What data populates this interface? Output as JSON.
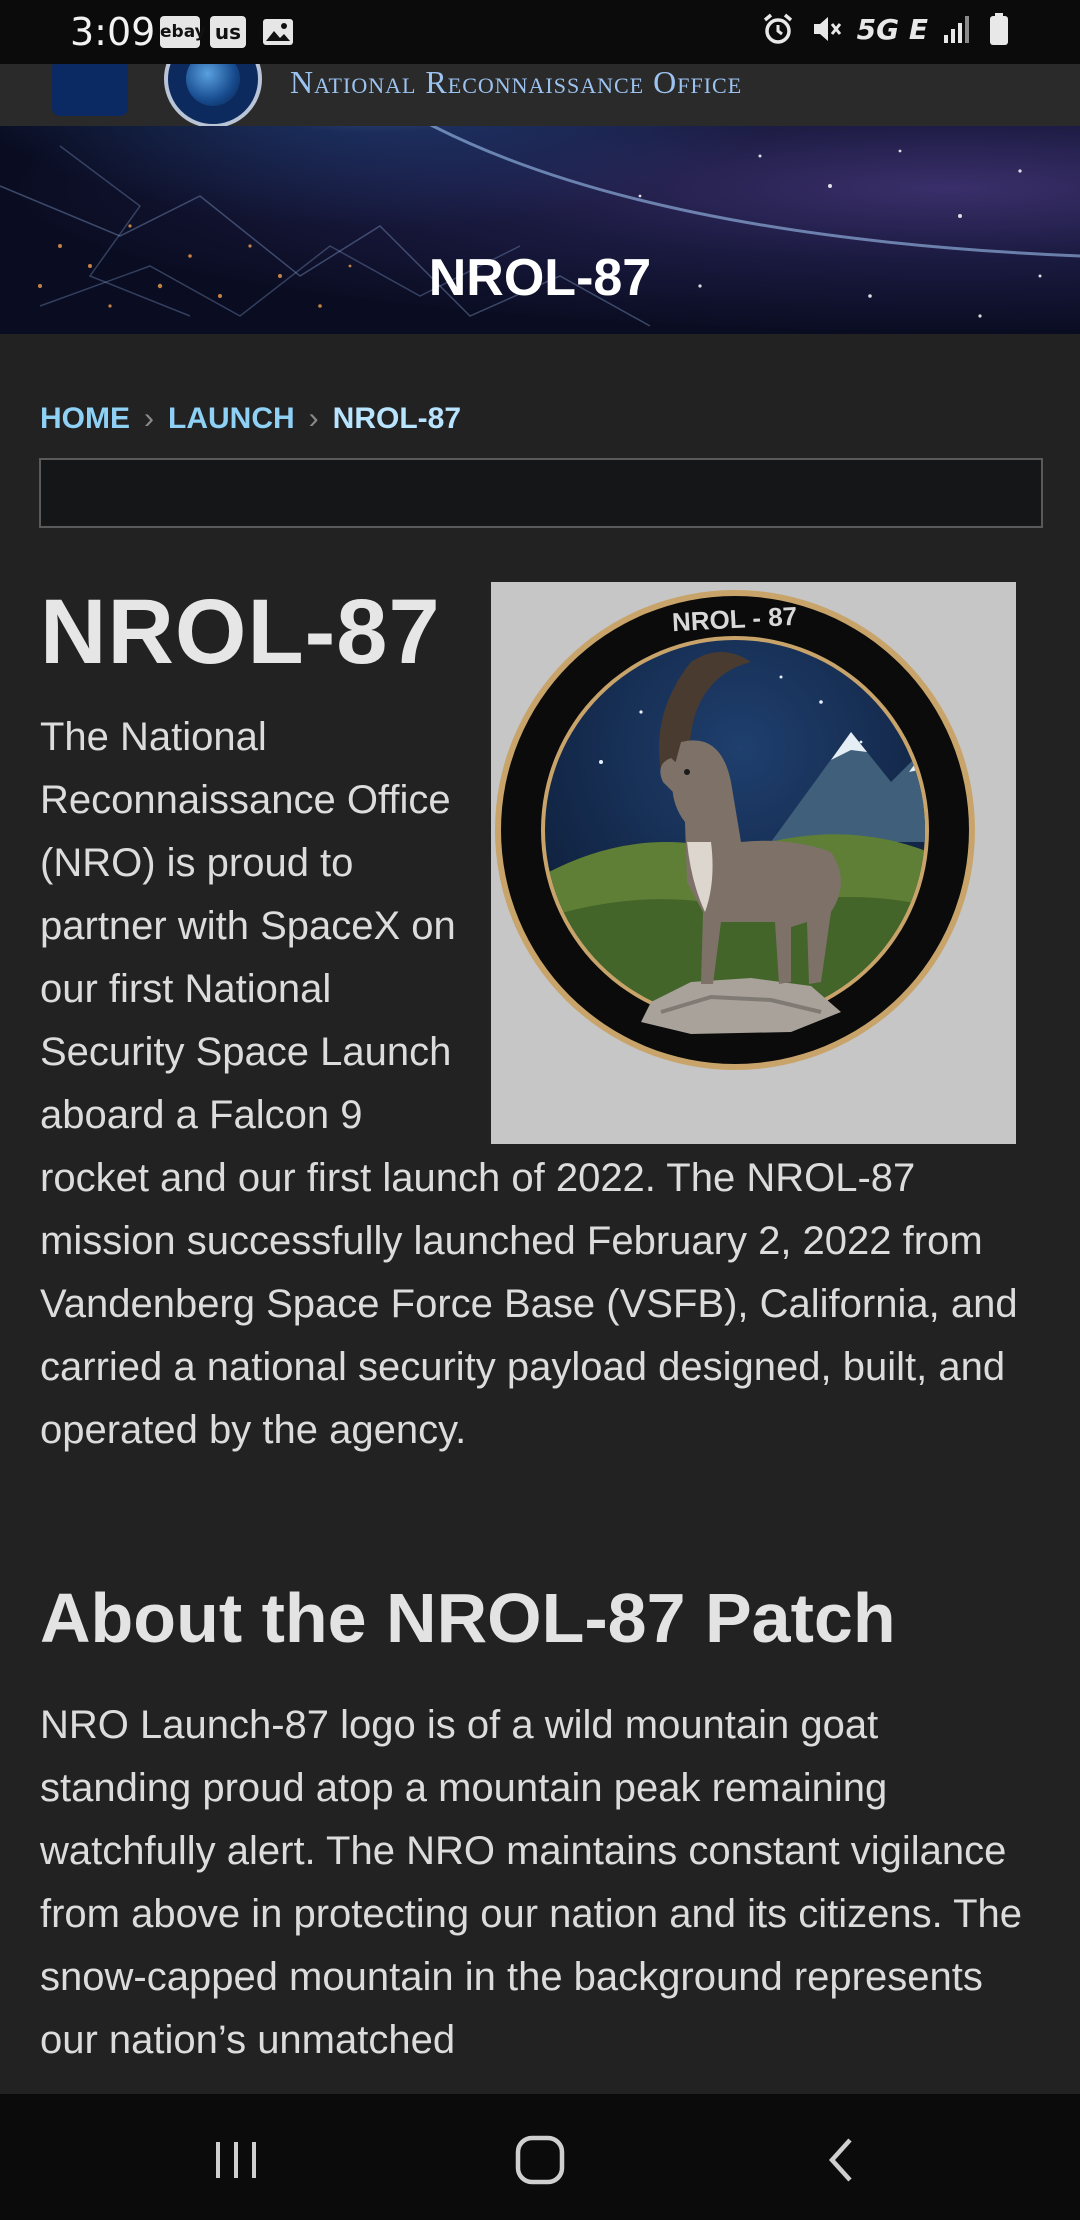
{
  "status": {
    "time": "3:09",
    "notifications": [
      "ebay",
      "us"
    ],
    "network": "5G E"
  },
  "header": {
    "site_title": "National Reconnaissance Office"
  },
  "hero": {
    "title": "NROL-87"
  },
  "breadcrumb": {
    "items": [
      "HOME",
      "LAUNCH",
      "NROL-87"
    ]
  },
  "article": {
    "title": "NROL-87",
    "patch_label": "NROL - 87",
    "intro": "The National Reconnaissance Office (NRO) is proud to partner with SpaceX on our first National Security Space Launch aboard a Falcon 9 rocket and our first launch of 2022. The NROL-87 mission successfully launched February 2, 2022 from Vandenberg Space Force Base (VSFB), California, and carried a national security payload designed, built, and operated by the agency.",
    "patch_heading": "About the NROL-87 Patch",
    "patch_text": "NRO Launch-87 logo is of a wild mountain goat standing proud atop a mountain peak remaining watchfully alert. The NRO maintains constant vigilance from above in protecting our nation and its citizens. The snow-capped mountain in the background represents our nation’s unmatched"
  },
  "colors": {
    "background": "#222222",
    "link": "#8fd0f5",
    "header_title": "#9cc3f0"
  }
}
